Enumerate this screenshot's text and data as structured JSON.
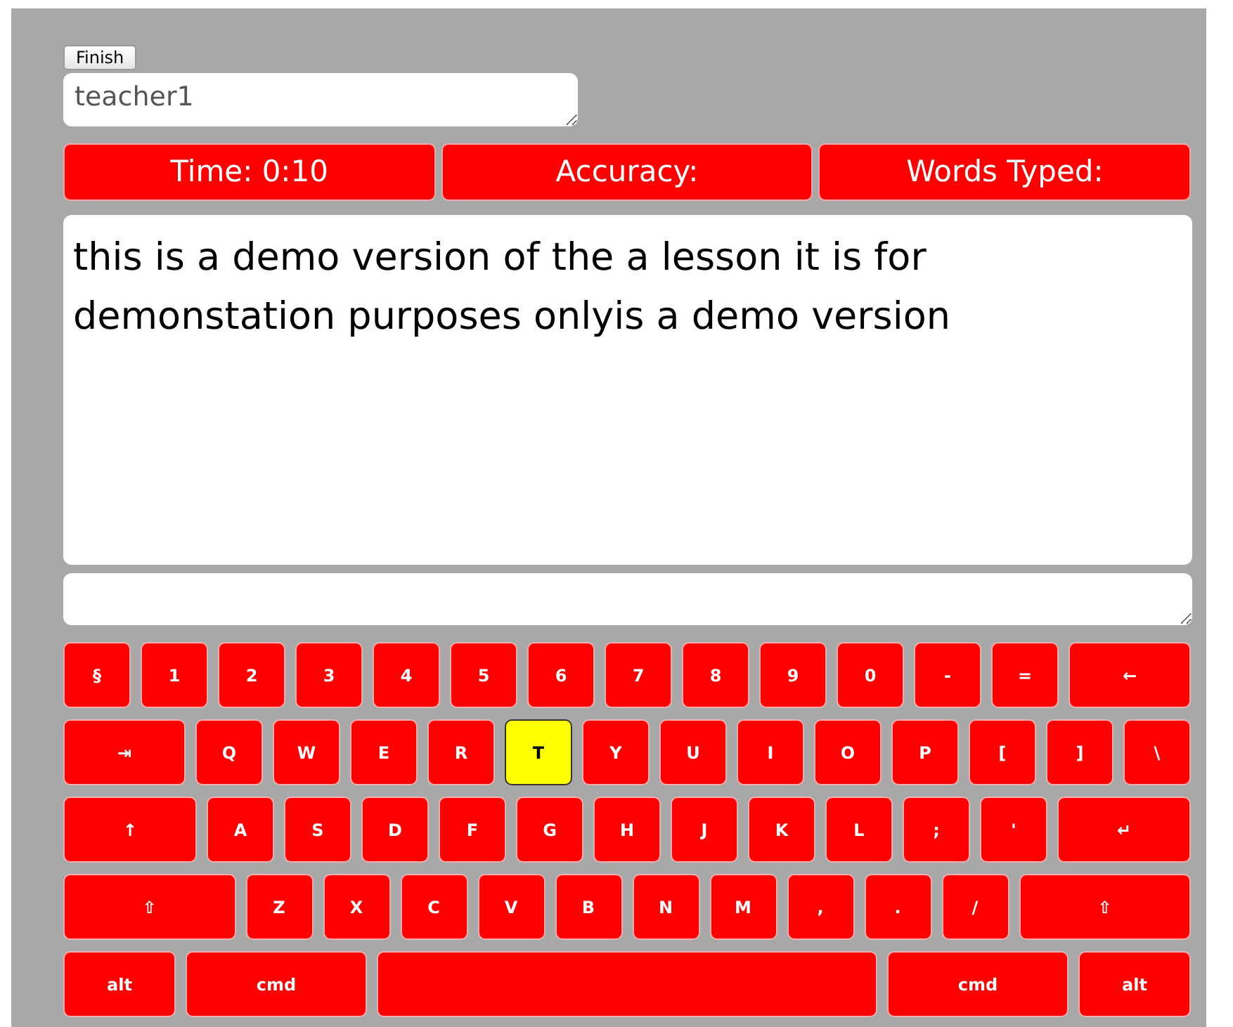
{
  "finish_button": {
    "label": "Finish"
  },
  "name_field": {
    "value": "teacher1"
  },
  "stats": [
    "Time: 0:10",
    "Accuracy:",
    "Words Typed:"
  ],
  "lesson_text": "this is a demo version of the a lesson it is for demonstation purposes onlyis a demo version",
  "keyboard": [
    [
      {
        "label": "§",
        "kind": "char",
        "selected": false
      },
      {
        "label": "1",
        "kind": "char",
        "selected": false
      },
      {
        "label": "2",
        "kind": "char",
        "selected": false
      },
      {
        "label": "3",
        "kind": "char",
        "selected": false
      },
      {
        "label": "4",
        "kind": "char",
        "selected": false
      },
      {
        "label": "5",
        "kind": "char",
        "selected": false
      },
      {
        "label": "6",
        "kind": "char",
        "selected": false
      },
      {
        "label": "7",
        "kind": "char",
        "selected": false
      },
      {
        "label": "8",
        "kind": "char",
        "selected": false
      },
      {
        "label": "9",
        "kind": "char",
        "selected": false
      },
      {
        "label": "0",
        "kind": "char",
        "selected": false
      },
      {
        "label": "-",
        "kind": "char",
        "selected": false
      },
      {
        "label": "=",
        "kind": "char",
        "selected": false
      },
      {
        "label": "←",
        "kind": "wide",
        "selected": false
      }
    ],
    [
      {
        "label": "⇥",
        "kind": "wide",
        "selected": false
      },
      {
        "label": "Q",
        "kind": "char",
        "selected": false
      },
      {
        "label": "W",
        "kind": "char",
        "selected": false
      },
      {
        "label": "E",
        "kind": "char",
        "selected": false
      },
      {
        "label": "R",
        "kind": "char",
        "selected": false
      },
      {
        "label": "T",
        "kind": "char",
        "selected": true
      },
      {
        "label": "Y",
        "kind": "char",
        "selected": false
      },
      {
        "label": "U",
        "kind": "char",
        "selected": false
      },
      {
        "label": "I",
        "kind": "char",
        "selected": false
      },
      {
        "label": "O",
        "kind": "char",
        "selected": false
      },
      {
        "label": "P",
        "kind": "char",
        "selected": false
      },
      {
        "label": "[",
        "kind": "char",
        "selected": false
      },
      {
        "label": "]",
        "kind": "char",
        "selected": false
      },
      {
        "label": "\\",
        "kind": "char",
        "selected": false
      }
    ],
    [
      {
        "label": "↑",
        "kind": "wide",
        "selected": false
      },
      {
        "label": "A",
        "kind": "char",
        "selected": false
      },
      {
        "label": "S",
        "kind": "char",
        "selected": false
      },
      {
        "label": "D",
        "kind": "char",
        "selected": false
      },
      {
        "label": "F",
        "kind": "char",
        "selected": false
      },
      {
        "label": "G",
        "kind": "char",
        "selected": false
      },
      {
        "label": "H",
        "kind": "char",
        "selected": false
      },
      {
        "label": "J",
        "kind": "char",
        "selected": false
      },
      {
        "label": "K",
        "kind": "char",
        "selected": false
      },
      {
        "label": "L",
        "kind": "char",
        "selected": false
      },
      {
        "label": ";",
        "kind": "char",
        "selected": false
      },
      {
        "label": "'",
        "kind": "char",
        "selected": false
      },
      {
        "label": "↵",
        "kind": "wide",
        "selected": false
      }
    ],
    [
      {
        "label": "⇧",
        "kind": "wide",
        "selected": false
      },
      {
        "label": "Z",
        "kind": "char",
        "selected": false
      },
      {
        "label": "X",
        "kind": "char",
        "selected": false
      },
      {
        "label": "C",
        "kind": "char",
        "selected": false
      },
      {
        "label": "V",
        "kind": "char",
        "selected": false
      },
      {
        "label": "B",
        "kind": "char",
        "selected": false
      },
      {
        "label": "N",
        "kind": "char",
        "selected": false
      },
      {
        "label": "M",
        "kind": "char",
        "selected": false
      },
      {
        "label": ",",
        "kind": "char",
        "selected": false
      },
      {
        "label": ".",
        "kind": "char",
        "selected": false
      },
      {
        "label": "/",
        "kind": "char",
        "selected": false
      },
      {
        "label": "⇧",
        "kind": "wide",
        "selected": false
      }
    ],
    [
      {
        "label": "alt",
        "kind": "alt",
        "selected": false
      },
      {
        "label": "cmd",
        "kind": "cmd",
        "selected": false
      },
      {
        "kind": "space",
        "selected": false
      },
      {
        "label": "cmd",
        "kind": "cmd",
        "selected": false
      },
      {
        "label": "alt",
        "kind": "alt",
        "selected": false
      }
    ]
  ]
}
